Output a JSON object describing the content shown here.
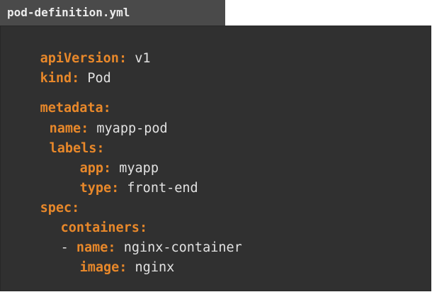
{
  "tab": {
    "filename": "pod-definition.yml"
  },
  "colors": {
    "key": "#e8882a",
    "value": "#e2e2e2",
    "editor_bg": "#303030",
    "tab_bg": "#4a4a4a"
  },
  "yaml": {
    "apiVersion": {
      "key": "apiVersion",
      "colon": ":",
      "value": "v1"
    },
    "kind": {
      "key": "kind",
      "colon": ":",
      "value": "Pod"
    },
    "metadata": {
      "key": "metadata",
      "colon": ":"
    },
    "name": {
      "key": "name",
      "colon": ":",
      "value": "myapp-pod"
    },
    "labels": {
      "key": "labels",
      "colon": ":"
    },
    "app": {
      "key": "app",
      "colon": ":",
      "value": "myapp"
    },
    "type": {
      "key": "type",
      "colon": ":",
      "value": "front-end"
    },
    "spec": {
      "key": "spec",
      "colon": ":"
    },
    "containers": {
      "key": "containers",
      "colon": ":"
    },
    "container_name": {
      "dash": "-",
      "key": "name",
      "colon": ":",
      "value": "nginx-container"
    },
    "image": {
      "key": "image",
      "colon": ":",
      "value": "nginx"
    }
  }
}
